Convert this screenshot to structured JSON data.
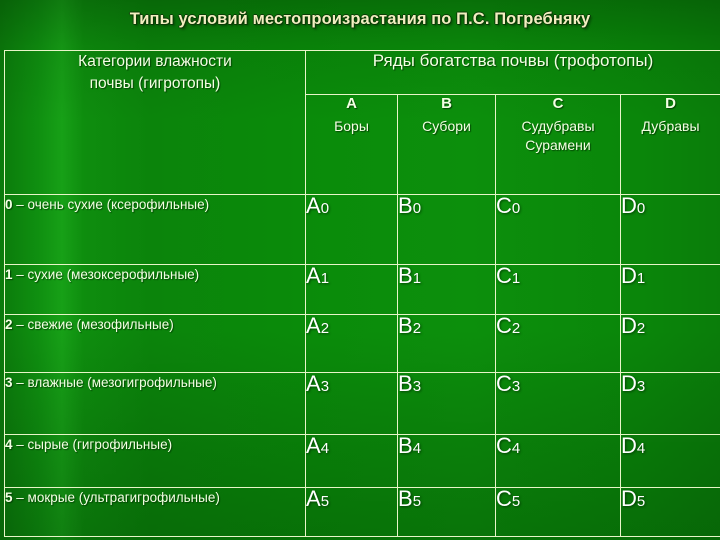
{
  "slide": {
    "title": "Типы условий местопроизрастания по П.С. Погребняку",
    "background_color": "#0a8b0a",
    "title_color": "#f2eec0",
    "text_color": "#f4ffe4",
    "border_color": "#e8f5c8"
  },
  "table": {
    "row_header": {
      "label_line1": "Категории влажности",
      "label_line2": "почвы (гигротопы)"
    },
    "col_header": {
      "title": "Ряды богатства почвы (трофотопы)",
      "columns": [
        {
          "letter": "A",
          "name": "Боры",
          "name2": ""
        },
        {
          "letter": "B",
          "name": "Субори",
          "name2": ""
        },
        {
          "letter": "C",
          "name": "Судубравы",
          "name2": "Сурамени"
        },
        {
          "letter": "D",
          "name": "Дубравы",
          "name2": ""
        }
      ]
    },
    "rows": [
      {
        "num": "0",
        "dash": " – ",
        "label": "очень сухие (ксерофильные)",
        "cells": [
          {
            "letter": "A",
            "sub": "0"
          },
          {
            "letter": "B",
            "sub": "0"
          },
          {
            "letter": "C",
            "sub": "0"
          },
          {
            "letter": "D",
            "sub": "0"
          }
        ]
      },
      {
        "num": "1",
        "dash": " – ",
        "label": "сухие (мезоксерофильные)",
        "cells": [
          {
            "letter": "A",
            "sub": "1"
          },
          {
            "letter": "B",
            "sub": "1"
          },
          {
            "letter": "C",
            "sub": "1"
          },
          {
            "letter": "D",
            "sub": "1"
          }
        ]
      },
      {
        "num": "2",
        "dash": " – ",
        "label": "свежие (мезофильные)",
        "cells": [
          {
            "letter": "A",
            "sub": "2"
          },
          {
            "letter": "B",
            "sub": "2"
          },
          {
            "letter": "C",
            "sub": "2"
          },
          {
            "letter": "D",
            "sub": "2"
          }
        ]
      },
      {
        "num": "3",
        "dash": " – ",
        "label": "влажные (мезогигрофильные)",
        "cells": [
          {
            "letter": "A",
            "sub": "3"
          },
          {
            "letter": "B",
            "sub": "3"
          },
          {
            "letter": "C",
            "sub": "3"
          },
          {
            "letter": "D",
            "sub": "3"
          }
        ]
      },
      {
        "num": "4",
        "dash": " – ",
        "label": "сырые (гигрофильные)",
        "cells": [
          {
            "letter": "A",
            "sub": "4"
          },
          {
            "letter": "B",
            "sub": "4"
          },
          {
            "letter": "C",
            "sub": "4"
          },
          {
            "letter": "D",
            "sub": "4"
          }
        ]
      },
      {
        "num": "5",
        "dash": " – ",
        "label": "мокрые (ультрагигрофильные)",
        "cells": [
          {
            "letter": "A",
            "sub": "5"
          },
          {
            "letter": "B",
            "sub": "5"
          },
          {
            "letter": "C",
            "sub": "5"
          },
          {
            "letter": "D",
            "sub": "5"
          }
        ]
      }
    ]
  }
}
